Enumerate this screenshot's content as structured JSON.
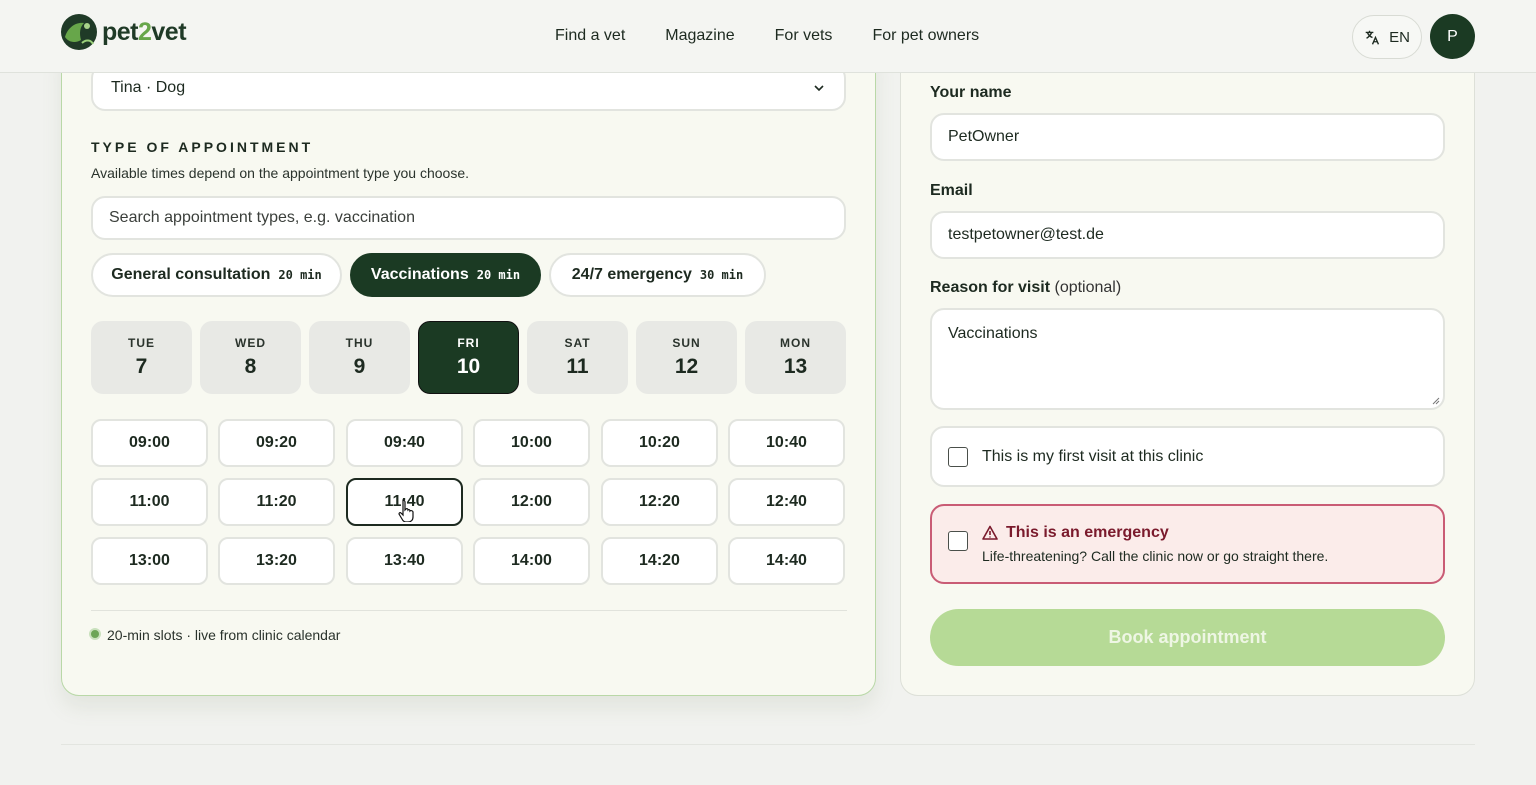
{
  "brand": {
    "name_a": "pet",
    "name_b": "2",
    "name_c": "vet",
    "accent": "#67a64a",
    "dark": "#1b3a23"
  },
  "nav": [
    {
      "label": "Find a vet"
    },
    {
      "label": "Magazine"
    },
    {
      "label": "For vets"
    },
    {
      "label": "For pet owners"
    }
  ],
  "language": {
    "icon": "translate-icon",
    "label": "EN"
  },
  "user": {
    "initial": "P"
  },
  "pet_select": {
    "value": "Tina · Dog",
    "icon": "chevron-down-icon"
  },
  "appointment": {
    "title": "TYPE OF APPOINTMENT",
    "description": "Available times depend on the appointment type you choose.",
    "search_placeholder": "Search appointment types, e.g. vaccination",
    "types": [
      {
        "label": "General consultation",
        "duration": "20 min",
        "selected": false
      },
      {
        "label": "Vaccinations",
        "duration": "20 min",
        "selected": true
      },
      {
        "label": "24/7 emergency",
        "duration": "30 min",
        "selected": false
      }
    ]
  },
  "days": [
    {
      "dow": "TUE",
      "num": "7",
      "selected": false
    },
    {
      "dow": "WED",
      "num": "8",
      "selected": false
    },
    {
      "dow": "THU",
      "num": "9",
      "selected": false
    },
    {
      "dow": "FRI",
      "num": "10",
      "selected": true
    },
    {
      "dow": "SAT",
      "num": "11",
      "selected": false
    },
    {
      "dow": "SUN",
      "num": "12",
      "selected": false
    },
    {
      "dow": "MON",
      "num": "13",
      "selected": false
    }
  ],
  "slots": [
    [
      "09:00",
      "09:20",
      "09:40",
      "10:00",
      "10:20",
      "10:40"
    ],
    [
      "11:00",
      "11:20",
      "11:40",
      "12:00",
      "12:20",
      "12:40"
    ],
    [
      "13:00",
      "13:20",
      "13:40",
      "14:00",
      "14:20",
      "14:40"
    ]
  ],
  "hovered_slot": "11:40",
  "live_note": "20-min slots · live from clinic calendar",
  "form": {
    "name_label": "Your name",
    "name_value": "PetOwner",
    "email_label": "Email",
    "email_value": "testpetowner@test.de",
    "reason_label": "Reason for visit",
    "reason_optional": "(optional)",
    "reason_value": "Vaccinations",
    "first_visit_label": "This is my first visit at this clinic",
    "emergency_title": "This is an emergency",
    "emergency_desc": "Life-threatening? Call the clinic now or go straight there.",
    "emergency_icon": "warning-triangle-icon",
    "emergency_color": "#c95c75",
    "book_label": "Book appointment"
  }
}
